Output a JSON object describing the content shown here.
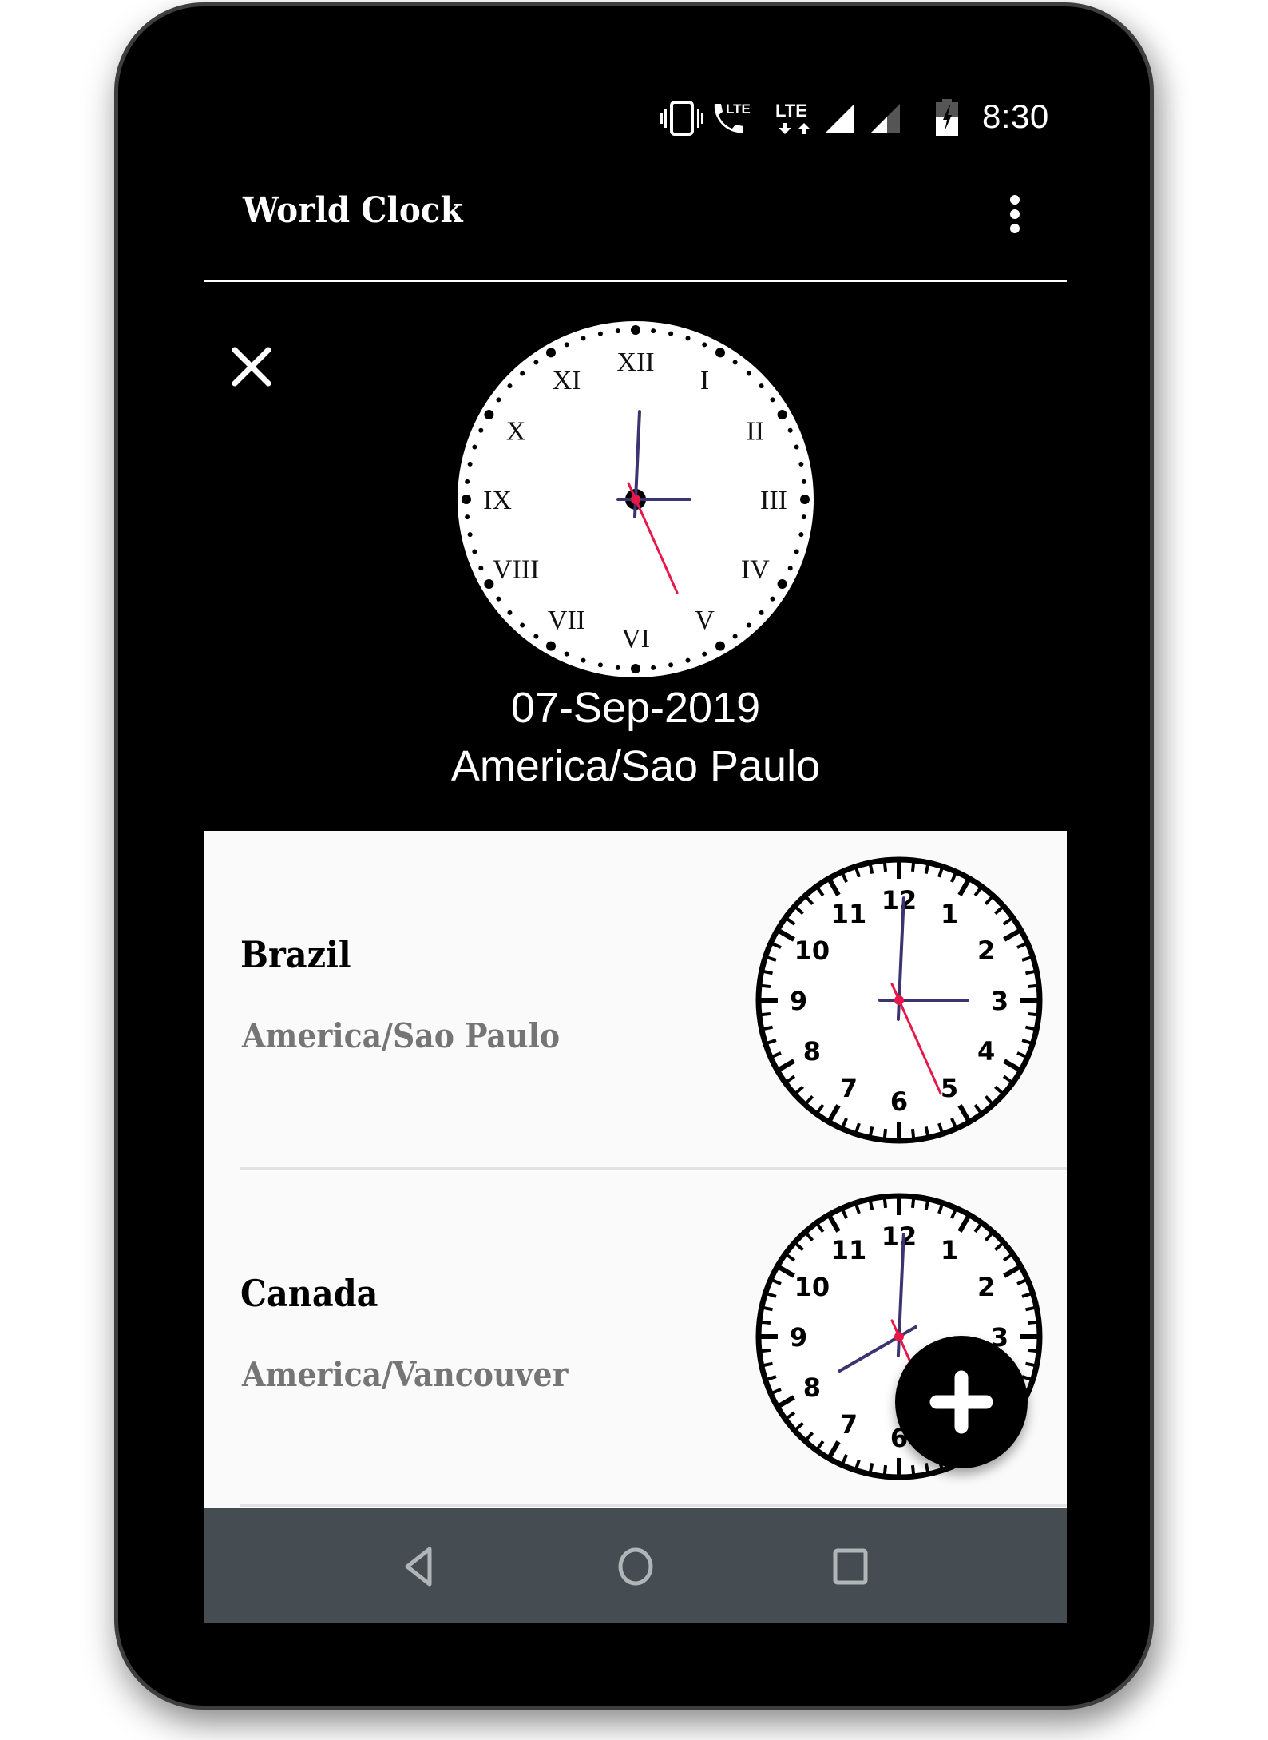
{
  "status_bar": {
    "time": "8:30",
    "icons": [
      "vibrate-icon",
      "volte-call-icon",
      "lte-data-icon",
      "signal-full-icon",
      "signal-partial-icon",
      "battery-charging-icon"
    ],
    "lte_label": "LTE"
  },
  "app_bar": {
    "title": "World Clock",
    "menu_icon": "more-vert-icon"
  },
  "selected": {
    "close_icon": "close-icon",
    "date": "07-Sep-2019",
    "timezone": "America/Sao Paulo",
    "clock": {
      "style": "roman",
      "hours": 3,
      "minutes": 0,
      "seconds": 26,
      "numerals": [
        "XII",
        "I",
        "II",
        "III",
        "IV",
        "V",
        "VI",
        "VII",
        "VIII",
        "IX",
        "X",
        "XI"
      ]
    }
  },
  "list": {
    "items": [
      {
        "country": "Brazil",
        "timezone": "America/Sao Paulo",
        "clock": {
          "hours": 3,
          "minutes": 0,
          "seconds": 26
        }
      },
      {
        "country": "Canada",
        "timezone": "America/Vancouver",
        "clock": {
          "hours": 8,
          "minutes": 0,
          "seconds": 26
        }
      }
    ],
    "arabic_numerals": [
      "12",
      "1",
      "2",
      "3",
      "4",
      "5",
      "6",
      "7",
      "8",
      "9",
      "10",
      "11"
    ]
  },
  "fab": {
    "icon": "add-icon",
    "label": "Add clock"
  },
  "nav_bar": {
    "back_icon": "back-icon",
    "home_icon": "home-icon",
    "recents_icon": "recents-icon"
  },
  "colors": {
    "hand": "#3b3470",
    "second_hand": "#e8174a",
    "list_bg": "#fafafa",
    "secondary_text": "#757575",
    "nav_bar": "#464d52"
  }
}
